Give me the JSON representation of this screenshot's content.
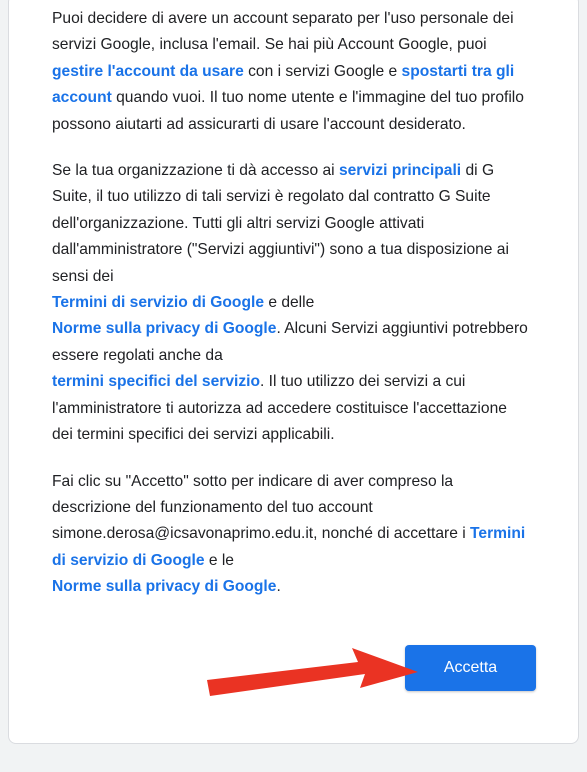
{
  "paragraph1": {
    "t1": "Puoi decidere di avere un account separato per l'uso personale dei servizi Google, inclusa l'email. Se hai più Account Google, puoi ",
    "link1": "gestire l'account da usare",
    "t2": " con i servizi Google e ",
    "link2": "spostarti tra gli account",
    "t3": " quando vuoi. Il tuo nome utente e l'immagine del tuo profilo possono aiutarti ad assicurarti di usare l'account desiderato."
  },
  "paragraph2": {
    "t1": "Se la tua organizzazione ti dà accesso ai ",
    "link1": "servizi principali",
    "t2": " di G Suite, il tuo utilizzo di tali servizi è regolato dal contratto G Suite dell'organizzazione. Tutti gli altri servizi Google attivati dall'amministratore (\"Servizi aggiuntivi\") sono a tua disposizione ai sensi dei ",
    "link2": "Termini di servizio di Google",
    "t3": " e delle ",
    "link3": "Norme sulla privacy di Google",
    "t4": ". Alcuni Servizi aggiuntivi potrebbero essere regolati anche da ",
    "link4": "termini specifici del servizio",
    "t5": ". Il tuo utilizzo dei servizi a cui l'amministratore ti autorizza ad accedere costituisce l'accettazione dei termini specifici dei servizi applicabili."
  },
  "paragraph3": {
    "t1": "Fai clic su \"Accetto\" sotto per indicare di aver compreso la descrizione del funzionamento del tuo account simone.derosa@icsavonaprimo.edu.it, nonché di accettare i ",
    "link1": "Termini di servizio di Google",
    "t2": " e le ",
    "link2": "Norme sulla privacy di Google",
    "t3": "."
  },
  "accept_button": {
    "label": "Accetta"
  },
  "colors": {
    "link": "#1a73e8",
    "button": "#1a73e8",
    "annotation_arrow": "#ea3323"
  }
}
